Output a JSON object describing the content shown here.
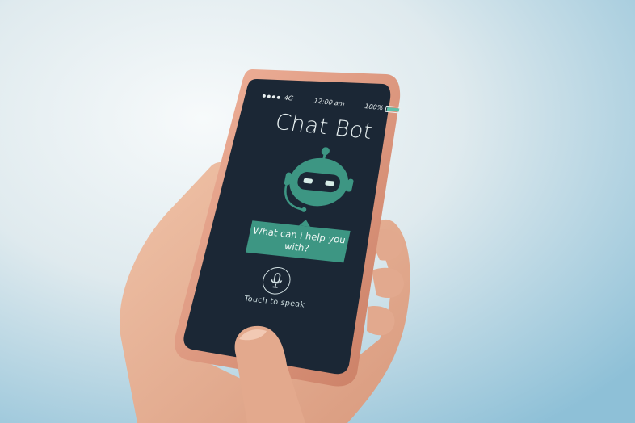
{
  "status_bar": {
    "network": "4G",
    "time": "12:00 am",
    "battery_text": "100%",
    "battery_level": 1.0
  },
  "chat": {
    "title": "Chat Bot",
    "prompt": "What can i help you with?",
    "mic_label": "Touch to speak"
  },
  "icons": {
    "avatar": "robot-icon",
    "mic": "microphone-icon"
  },
  "colors": {
    "screen_bg": "#1b2735",
    "accent": "#3d9683",
    "phone_frame": "#d9917a",
    "background_light": "#f2f6f7",
    "background_blue": "#8fc1d8"
  }
}
